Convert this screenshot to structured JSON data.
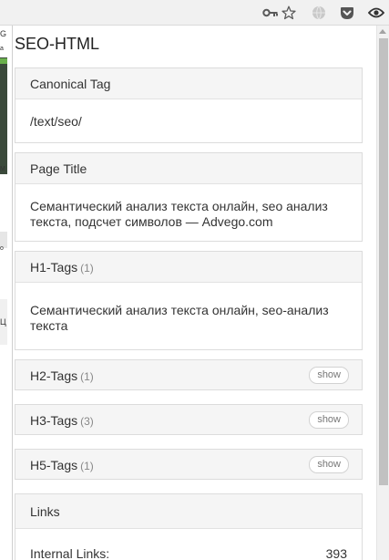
{
  "browser": {
    "icons": [
      "key-icon",
      "star-icon",
      "globe-extension-icon",
      "pocket-icon",
      "seo-eye-icon"
    ]
  },
  "background_page": {
    "fragments": [
      "G",
      "a",
      "M",
      "o",
      "Ц"
    ]
  },
  "popup": {
    "title": "SEO-HTML",
    "canonical": {
      "label": "Canonical Tag",
      "value": "/text/seo/"
    },
    "page_title": {
      "label": "Page Title",
      "value": "Семантический анализ текста онлайн, seo анализ текста, подсчет символов — Advego.com"
    },
    "h1": {
      "label": "H1-Tags",
      "count": "(1)",
      "value": "Семантический анализ текста онлайн, seo-анализ текста"
    },
    "h2": {
      "label": "H2-Tags",
      "count": "(1)",
      "button": "show"
    },
    "h3": {
      "label": "H3-Tags",
      "count": "(3)",
      "button": "show"
    },
    "h5": {
      "label": "H5-Tags",
      "count": "(1)",
      "button": "show"
    },
    "links": {
      "label": "Links",
      "internal_label": "Internal Links:",
      "internal_value": "393"
    }
  },
  "colors": {
    "section_header_bg": "#f5f5f5",
    "border": "#dcdcdc",
    "text": "#333333",
    "muted": "#888888"
  }
}
